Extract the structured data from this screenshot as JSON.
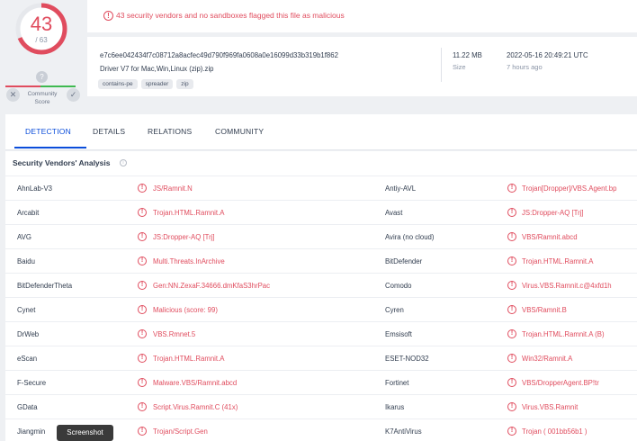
{
  "score": {
    "detections": "43",
    "total": "/ 63"
  },
  "community": {
    "question": "?",
    "label_line1": "Community",
    "label_line2": "Score",
    "downvote": "✕",
    "upvote": "✓"
  },
  "alert": {
    "icon": "!",
    "text": "43 security vendors and no sandboxes flagged this file as malicious"
  },
  "file": {
    "hash": "e7c6ee042434f7c08712a8acfec49d790f969fa0608a0e16099d33b319b1f862",
    "name": "Driver V7 for Mac,Win,Linux (zip).zip",
    "tags": [
      "contains-pe",
      "spreader",
      "zip"
    ],
    "size": "11.22 MB",
    "size_label": "Size",
    "date": "2022-05-16 20:49:21 UTC",
    "date_ago": "7 hours ago"
  },
  "tabs": [
    "DETECTION",
    "DETAILS",
    "RELATIONS",
    "COMMUNITY"
  ],
  "section": {
    "title": "Security Vendors' Analysis",
    "info_icon": "i"
  },
  "vendors": [
    {
      "left_name": "AhnLab-V3",
      "left_result": "JS/Ramnit.N",
      "right_name": "Antiy-AVL",
      "right_result": "Trojan[Dropper]/VBS.Agent.bp"
    },
    {
      "left_name": "Arcabit",
      "left_result": "Trojan.HTML.Ramnit.A",
      "right_name": "Avast",
      "right_result": "JS:Dropper-AQ [Trj]"
    },
    {
      "left_name": "AVG",
      "left_result": "JS:Dropper-AQ [Trj]",
      "right_name": "Avira (no cloud)",
      "right_result": "VBS/Ramnit.abcd"
    },
    {
      "left_name": "Baidu",
      "left_result": "Multi.Threats.InArchive",
      "right_name": "BitDefender",
      "right_result": "Trojan.HTML.Ramnit.A"
    },
    {
      "left_name": "BitDefenderTheta",
      "left_result": "Gen:NN.ZexaF.34666.dmKfaS3hrPac",
      "right_name": "Comodo",
      "right_result": "Virus.VBS.Ramnit.c@4xfd1h"
    },
    {
      "left_name": "Cynet",
      "left_result": "Malicious (score: 99)",
      "right_name": "Cyren",
      "right_result": "VBS/Ramnit.B"
    },
    {
      "left_name": "DrWeb",
      "left_result": "VBS.Rmnet.5",
      "right_name": "Emsisoft",
      "right_result": "Trojan.HTML.Ramnit.A (B)"
    },
    {
      "left_name": "eScan",
      "left_result": "Trojan.HTML.Ramnit.A",
      "right_name": "ESET-NOD32",
      "right_result": "Win32/Ramnit.A"
    },
    {
      "left_name": "F-Secure",
      "left_result": "Malware.VBS/Ramnit.abcd",
      "right_name": "Fortinet",
      "right_result": "VBS/DropperAgent.BP!tr"
    },
    {
      "left_name": "GData",
      "left_result": "Script.Virus.Ramnit.C (41x)",
      "right_name": "Ikarus",
      "right_result": "Virus.VBS.Ramnit"
    },
    {
      "left_name": "Jiangmin",
      "left_result": "Trojan/Script.Gen",
      "right_name": "K7AntiVirus",
      "right_result": "Trojan ( 001bb56b1 )"
    }
  ],
  "tooltip": "Screenshot",
  "colors": {
    "accent": "#0b4dda",
    "danger": "#e04c5e",
    "ok": "#3fb950"
  }
}
